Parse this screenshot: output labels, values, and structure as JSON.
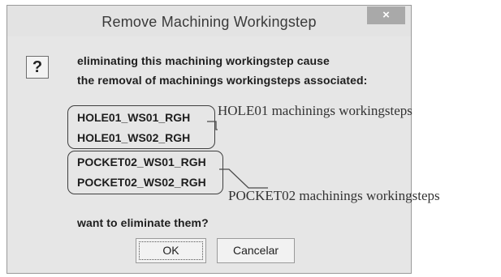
{
  "dialog": {
    "title": "Remove  Machining Workingstep",
    "close_label": "×",
    "icon": "question-icon",
    "icon_glyph": "?",
    "message_line1": "eliminating this machining workingstep cause",
    "message_line2": "the removal of machinings workingsteps associated:",
    "groups": [
      {
        "items": [
          "HOLE01_WS01_RGH",
          "HOLE01_WS02_RGH"
        ]
      },
      {
        "items": [
          "POCKET02_WS01_RGH",
          "POCKET02_WS02_RGH"
        ]
      }
    ],
    "question": "want to eliminate them?",
    "ok_label": "OK",
    "cancel_label": "Cancelar"
  },
  "annotations": {
    "hole_group": "HOLE01 machinings workingsteps",
    "pocket_group": "POCKET02 machinings workingsteps"
  }
}
